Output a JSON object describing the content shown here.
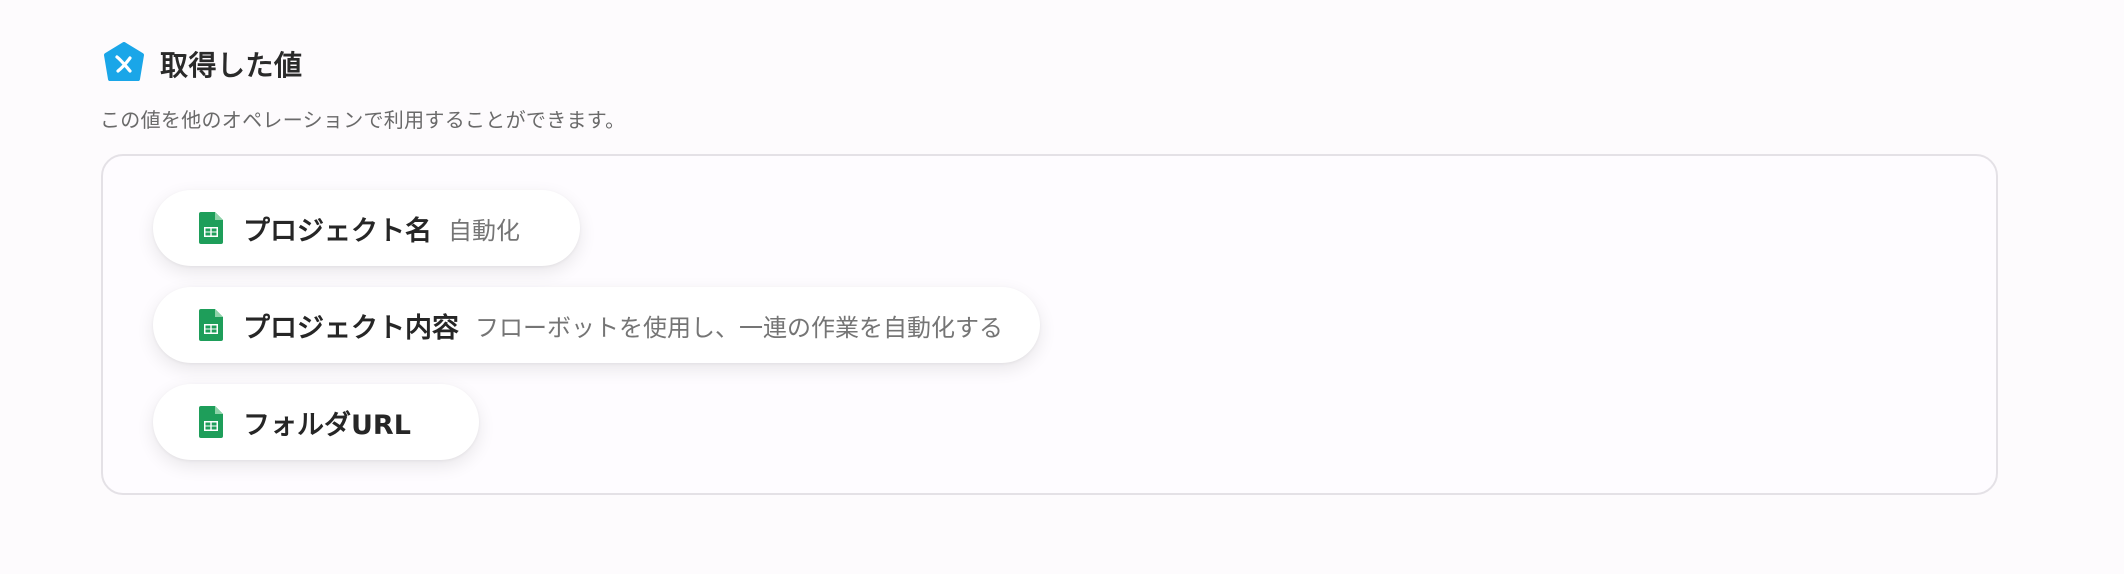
{
  "section": {
    "title": "取得した値",
    "subtitle": "この値を他のオペレーションで利用することができます。",
    "icon": "yoom-logo-icon",
    "icon_color": "#1aa6e8"
  },
  "items": [
    {
      "label": "プロジェクト名",
      "value": "自動化",
      "icon": "google-sheets-icon"
    },
    {
      "label": "プロジェクト内容",
      "value": "フローボットを使用し、一連の作業を自動化する",
      "icon": "google-sheets-icon"
    },
    {
      "label": "フォルダURL",
      "value": "",
      "icon": "google-sheets-icon"
    }
  ],
  "colors": {
    "sheets_green": "#1e9e5a",
    "border": "#e4e1e6"
  }
}
